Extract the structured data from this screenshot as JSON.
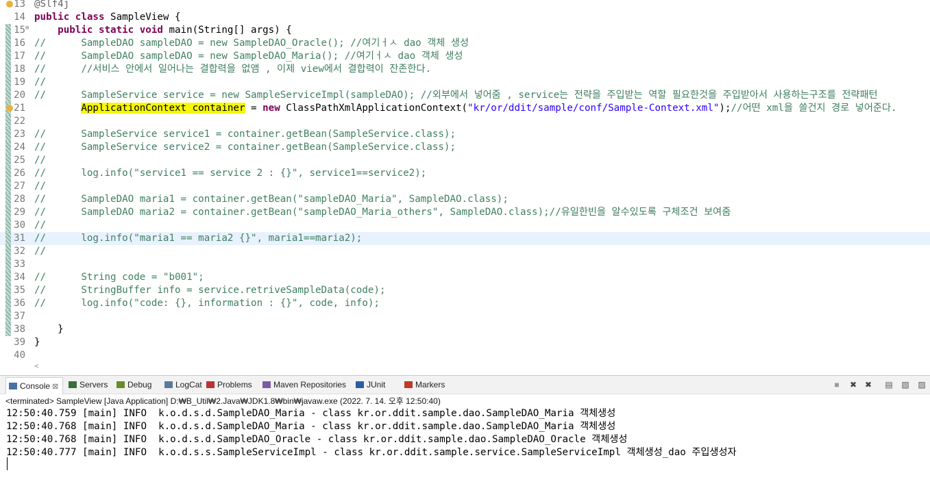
{
  "editor": {
    "lines": [
      {
        "num": "13",
        "fold": false,
        "mark": false,
        "warn": true,
        "current": false,
        "segs": [
          {
            "t": "ann",
            "v": "@Slf4j"
          }
        ]
      },
      {
        "num": "14",
        "fold": false,
        "mark": false,
        "warn": false,
        "current": false,
        "segs": [
          {
            "t": "kw",
            "v": "public class"
          },
          {
            "t": "p",
            "v": " SampleView {"
          }
        ]
      },
      {
        "num": "15",
        "fold": true,
        "mark": true,
        "warn": false,
        "current": false,
        "segs": [
          {
            "t": "p",
            "v": "    "
          },
          {
            "t": "kw",
            "v": "public static void"
          },
          {
            "t": "p",
            "v": " main(String[] args) {"
          }
        ]
      },
      {
        "num": "16",
        "fold": false,
        "mark": true,
        "warn": false,
        "current": false,
        "segs": [
          {
            "t": "cm",
            "v": "//      SampleDAO sampleDAO = new SampleDAO_Oracle(); //여기ㅓㅅ dao 객체 생성"
          }
        ]
      },
      {
        "num": "17",
        "fold": false,
        "mark": true,
        "warn": false,
        "current": false,
        "segs": [
          {
            "t": "cm",
            "v": "//      SampleDAO sampleDAO = new SampleDAO_Maria(); //여기ㅓㅅ dao 객체 생성"
          }
        ]
      },
      {
        "num": "18",
        "fold": false,
        "mark": true,
        "warn": false,
        "current": false,
        "segs": [
          {
            "t": "cm",
            "v": "//      //서비스 안에서 일어나는 결합력을 없앰 , 이제 view에서 결합력이 잔존한다."
          }
        ]
      },
      {
        "num": "19",
        "fold": false,
        "mark": true,
        "warn": false,
        "current": false,
        "segs": [
          {
            "t": "cm",
            "v": "//"
          }
        ]
      },
      {
        "num": "20",
        "fold": false,
        "mark": true,
        "warn": false,
        "current": false,
        "segs": [
          {
            "t": "cm",
            "v": "//      SampleService service = new SampleServiceImpl(sampleDAO); //외부에서 넣어줌 , service는 전략을 주입받는 역할 필요한것을 주입받아서 사용하는구조를 전략패턴"
          }
        ]
      },
      {
        "num": "21",
        "fold": false,
        "mark": true,
        "warn": true,
        "current": false,
        "segs": [
          {
            "t": "p",
            "v": "        "
          },
          {
            "t": "hl",
            "v": "ApplicationContext container"
          },
          {
            "t": "p",
            "v": " = "
          },
          {
            "t": "kw",
            "v": "new"
          },
          {
            "t": "p",
            "v": " ClassPathXmlApplicationContext("
          },
          {
            "t": "str",
            "v": "\"kr/or/ddit/sample/conf/Sample-Context.xml\""
          },
          {
            "t": "p",
            "v": ");"
          },
          {
            "t": "cm",
            "v": "//어떤 xml을 쓸건지 경로 넣어준다."
          }
        ]
      },
      {
        "num": "22",
        "fold": false,
        "mark": true,
        "warn": false,
        "current": false,
        "segs": []
      },
      {
        "num": "23",
        "fold": false,
        "mark": true,
        "warn": false,
        "current": false,
        "segs": [
          {
            "t": "cm",
            "v": "//      SampleService service1 = container.getBean(SampleService.class);"
          }
        ]
      },
      {
        "num": "24",
        "fold": false,
        "mark": true,
        "warn": false,
        "current": false,
        "segs": [
          {
            "t": "cm",
            "v": "//      SampleService service2 = container.getBean(SampleService.class);"
          }
        ]
      },
      {
        "num": "25",
        "fold": false,
        "mark": true,
        "warn": false,
        "current": false,
        "segs": [
          {
            "t": "cm",
            "v": "//"
          }
        ]
      },
      {
        "num": "26",
        "fold": false,
        "mark": true,
        "warn": false,
        "current": false,
        "segs": [
          {
            "t": "cm",
            "v": "//      log.info(\"service1 == service 2 : {}\", service1==service2);"
          }
        ]
      },
      {
        "num": "27",
        "fold": false,
        "mark": true,
        "warn": false,
        "current": false,
        "segs": [
          {
            "t": "cm",
            "v": "//"
          }
        ]
      },
      {
        "num": "28",
        "fold": false,
        "mark": true,
        "warn": false,
        "current": false,
        "segs": [
          {
            "t": "cm",
            "v": "//      SampleDAO maria1 = container.getBean(\"sampleDAO_Maria\", SampleDAO.class);"
          }
        ]
      },
      {
        "num": "29",
        "fold": false,
        "mark": true,
        "warn": false,
        "current": false,
        "segs": [
          {
            "t": "cm",
            "v": "//      SampleDAO maria2 = container.getBean(\"sampleDAO_Maria_others\", SampleDAO.class);//유일한빈을 알수있도록 구체조건 보여줌"
          }
        ]
      },
      {
        "num": "30",
        "fold": false,
        "mark": true,
        "warn": false,
        "current": false,
        "segs": [
          {
            "t": "cm",
            "v": "//"
          }
        ]
      },
      {
        "num": "31",
        "fold": false,
        "mark": true,
        "warn": false,
        "current": true,
        "segs": [
          {
            "t": "cm",
            "v": "//      log.info(\"maria1 == maria2 {}\", maria1==maria2);"
          }
        ]
      },
      {
        "num": "32",
        "fold": false,
        "mark": true,
        "warn": false,
        "current": false,
        "segs": [
          {
            "t": "cm",
            "v": "//"
          }
        ]
      },
      {
        "num": "33",
        "fold": false,
        "mark": true,
        "warn": false,
        "current": false,
        "segs": []
      },
      {
        "num": "34",
        "fold": false,
        "mark": true,
        "warn": false,
        "current": false,
        "segs": [
          {
            "t": "cm",
            "v": "//      String code = \"b001\";"
          }
        ]
      },
      {
        "num": "35",
        "fold": false,
        "mark": true,
        "warn": false,
        "current": false,
        "segs": [
          {
            "t": "cm",
            "v": "//      StringBuffer info = service.retriveSampleData(code);"
          }
        ]
      },
      {
        "num": "36",
        "fold": false,
        "mark": true,
        "warn": false,
        "current": false,
        "segs": [
          {
            "t": "cm",
            "v": "//      log.info(\"code: {}, information : {}\", code, info);"
          }
        ]
      },
      {
        "num": "37",
        "fold": false,
        "mark": true,
        "warn": false,
        "current": false,
        "segs": []
      },
      {
        "num": "38",
        "fold": false,
        "mark": true,
        "warn": false,
        "current": false,
        "segs": [
          {
            "t": "p",
            "v": "    }"
          }
        ]
      },
      {
        "num": "39",
        "fold": false,
        "mark": false,
        "warn": false,
        "current": false,
        "segs": [
          {
            "t": "p",
            "v": "}"
          }
        ]
      },
      {
        "num": "40",
        "fold": false,
        "mark": false,
        "warn": false,
        "current": false,
        "segs": []
      }
    ],
    "scroll_arrow": "<"
  },
  "console": {
    "tabs": [
      {
        "label": "Console",
        "icon": "console-icon",
        "active": true,
        "close": "⊠"
      },
      {
        "label": "Servers",
        "icon": "servers-icon",
        "active": false
      },
      {
        "label": "Debug",
        "icon": "debug-icon",
        "active": false
      },
      {
        "label": "LogCat",
        "icon": "logcat-icon",
        "active": false
      },
      {
        "label": "Problems",
        "icon": "problems-icon",
        "active": false
      },
      {
        "label": "Maven Repositories",
        "icon": "maven-icon",
        "active": false
      },
      {
        "label": "JUnit",
        "icon": "junit-icon",
        "active": false
      },
      {
        "label": "Markers",
        "icon": "markers-icon",
        "active": false
      }
    ],
    "toolbar": [
      {
        "name": "terminate-icon",
        "glyph": "■"
      },
      {
        "name": "remove-launch-icon",
        "glyph": "✖"
      },
      {
        "name": "remove-all-icon",
        "glyph": "✖"
      },
      {
        "name": "clear-console-icon",
        "glyph": "▤"
      },
      {
        "name": "scroll-lock-icon",
        "glyph": "▧"
      },
      {
        "name": "word-wrap-icon",
        "glyph": "▨"
      }
    ],
    "status": "<terminated> SampleView [Java Application] D:₩B_Util₩2.Java₩JDK1.8₩bin₩javaw.exe (2022. 7. 14. 오후 12:50:40)",
    "output": [
      "12:50:40.759 [main] INFO  k.o.d.s.d.SampleDAO_Maria - class kr.or.ddit.sample.dao.SampleDAO_Maria 객체생성",
      "12:50:40.768 [main] INFO  k.o.d.s.d.SampleDAO_Maria - class kr.or.ddit.sample.dao.SampleDAO_Maria 객체생성",
      "12:50:40.768 [main] INFO  k.o.d.s.d.SampleDAO_Oracle - class kr.or.ddit.sample.dao.SampleDAO_Oracle 객체생성",
      "12:50:40.777 [main] INFO  k.o.d.s.s.SampleServiceImpl - class kr.or.ddit.sample.service.SampleServiceImpl 객체생성_dao 주입생성자"
    ]
  },
  "colors": {
    "keyword": "#7f0055",
    "comment": "#3f7f5f",
    "string": "#2a00ff",
    "highlight": "#f7f700"
  }
}
